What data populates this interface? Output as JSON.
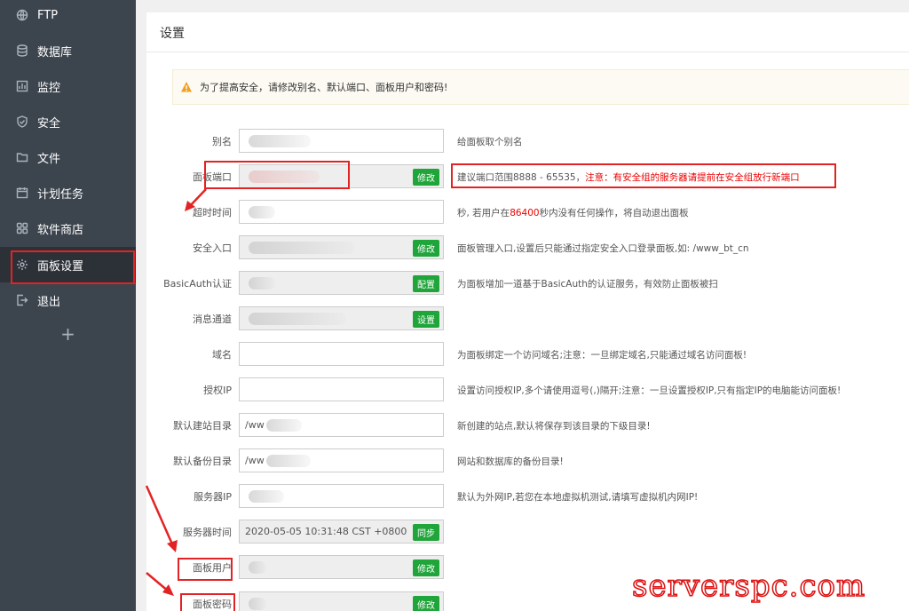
{
  "sidebar": {
    "items": [
      {
        "label": "FTP",
        "icon": "ftp-icon"
      },
      {
        "label": "数据库",
        "icon": "database-icon"
      },
      {
        "label": "监控",
        "icon": "monitor-icon"
      },
      {
        "label": "安全",
        "icon": "shield-icon"
      },
      {
        "label": "文件",
        "icon": "folder-icon"
      },
      {
        "label": "计划任务",
        "icon": "calendar-icon"
      },
      {
        "label": "软件商店",
        "icon": "grid-icon"
      },
      {
        "label": "面板设置",
        "icon": "gear-icon",
        "active": true
      },
      {
        "label": "退出",
        "icon": "logout-icon"
      }
    ],
    "add_label": "+"
  },
  "main": {
    "title": "设置",
    "alert": "为了提高安全，请修改别名、默认端口、面板用户和密码!",
    "rows": [
      {
        "label": "别名",
        "value": "",
        "hint": "给面板取个别名"
      },
      {
        "label": "面板端口",
        "value": "",
        "button": "修改",
        "hint": "建议端口范围8888 - 65535，",
        "hint_red": "注意：有安全组的服务器请提前在安全组放行新端口"
      },
      {
        "label": "超时时间",
        "value": "",
        "hint_pre": "秒, 若用户在",
        "hint_red": "86400",
        "hint_post": "秒内没有任何操作，将自动退出面板"
      },
      {
        "label": "安全入口",
        "value": "",
        "button": "修改",
        "hint": "面板管理入口,设置后只能通过指定安全入口登录面板,如: /www_bt_cn"
      },
      {
        "label": "BasicAuth认证",
        "value": "",
        "button": "配置",
        "hint": "为面板增加一道基于BasicAuth的认证服务，有效防止面板被扫"
      },
      {
        "label": "消息通道",
        "value": "",
        "button": "设置",
        "hint": ""
      },
      {
        "label": "域名",
        "value": "",
        "hint": "为面板绑定一个访问域名;注意：一旦绑定域名,只能通过域名访问面板!"
      },
      {
        "label": "授权IP",
        "value": "",
        "hint": "设置访问授权IP,多个请使用逗号(,)隔开;注意：一旦设置授权IP,只有指定IP的电脑能访问面板!"
      },
      {
        "label": "默认建站目录",
        "value": "/ww",
        "hint": "新创建的站点,默认将保存到该目录的下级目录!"
      },
      {
        "label": "默认备份目录",
        "value": "/ww",
        "hint": "网站和数据库的备份目录!"
      },
      {
        "label": "服务器IP",
        "value": "",
        "hint": "默认为外网IP,若您在本地虚拟机测试,请填写虚拟机内网IP!"
      },
      {
        "label": "服务器时间",
        "value": "2020-05-05 10:31:48 CST +0800",
        "button": "同步",
        "hint": ""
      },
      {
        "label": "面板用户",
        "value": "",
        "button": "修改",
        "hint": ""
      },
      {
        "label": "面板密码",
        "value": "",
        "button": "修改",
        "hint": ""
      }
    ]
  },
  "watermark": "serverspc.com",
  "colors": {
    "sidebar": "#3c444d",
    "active": "#2c3138",
    "button": "#20a53a",
    "annotation": "#e32323"
  }
}
